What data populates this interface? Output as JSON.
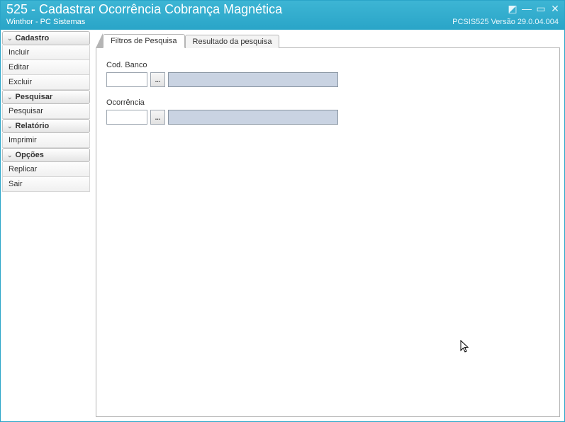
{
  "window": {
    "title": "525 - Cadastrar Ocorrência Cobrança Magnética",
    "subtitle": "Winthor - PC Sistemas",
    "version": "PCSIS525  Versão  29.0.04.004"
  },
  "sidebar": {
    "groups": [
      {
        "header": "Cadastro",
        "items": [
          "Incluir",
          "Editar",
          "Excluir"
        ]
      },
      {
        "header": "Pesquisar",
        "items": [
          "Pesquisar"
        ]
      },
      {
        "header": "Relatório",
        "items": [
          "Imprimir"
        ]
      },
      {
        "header": "Opções",
        "items": [
          "Replicar",
          "Sair"
        ]
      }
    ]
  },
  "tabs": {
    "active": "Filtros de Pesquisa",
    "items": [
      "Filtros de Pesquisa",
      "Resultado da pesquisa"
    ]
  },
  "form": {
    "codBanco": {
      "label": "Cod. Banco",
      "value": "",
      "lookup": "...",
      "desc": ""
    },
    "ocorrencia": {
      "label": "Ocorrência",
      "value": "",
      "lookup": "...",
      "desc": ""
    }
  }
}
